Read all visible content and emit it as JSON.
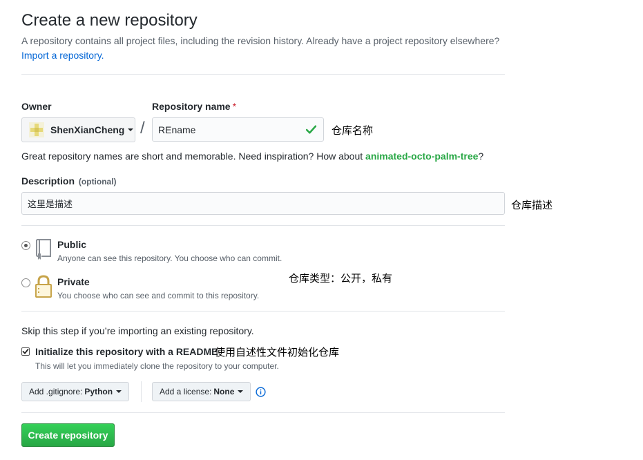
{
  "header": {
    "title": "Create a new repository",
    "subtitle": "A repository contains all project files, including the revision history. Already have a project repository elsewhere?",
    "import_link": "Import a repository."
  },
  "owner": {
    "label": "Owner",
    "name": "ShenXianCheng"
  },
  "repo_name": {
    "label": "Repository name",
    "required_mark": "*",
    "value": "REname",
    "annotation": "仓库名称"
  },
  "separator": "/",
  "hint": {
    "prefix": "Great repository names are short and memorable. Need inspiration? How about ",
    "suggestion": "animated-octo-palm-tree",
    "suffix": "?"
  },
  "description": {
    "label": "Description",
    "optional": "(optional)",
    "value": "这里是描述",
    "annotation": "仓库描述"
  },
  "visibility": {
    "annotation": "仓库类型：公开，私有",
    "selected": "public",
    "options": [
      {
        "title": "Public",
        "desc": "Anyone can see this repository. You choose who can commit.",
        "icon": "repo-book-icon"
      },
      {
        "title": "Private",
        "desc": "You choose who can see and commit to this repository.",
        "icon": "lock-icon"
      }
    ]
  },
  "init": {
    "skip_text": "Skip this step if you’re importing an existing repository.",
    "checkbox_label": "Initialize this repository with a README",
    "checked": true,
    "desc": "This will let you immediately clone the repository to your computer.",
    "annotation": "使用自述性文件初始化仓库"
  },
  "gitignore": {
    "label": "Add .gitignore:",
    "value": "Python"
  },
  "license": {
    "label": "Add a license:",
    "value": "None"
  },
  "submit": {
    "label": "Create repository"
  },
  "colors": {
    "link": "#0366d6",
    "success": "#28a745",
    "required": "#cb2431"
  }
}
